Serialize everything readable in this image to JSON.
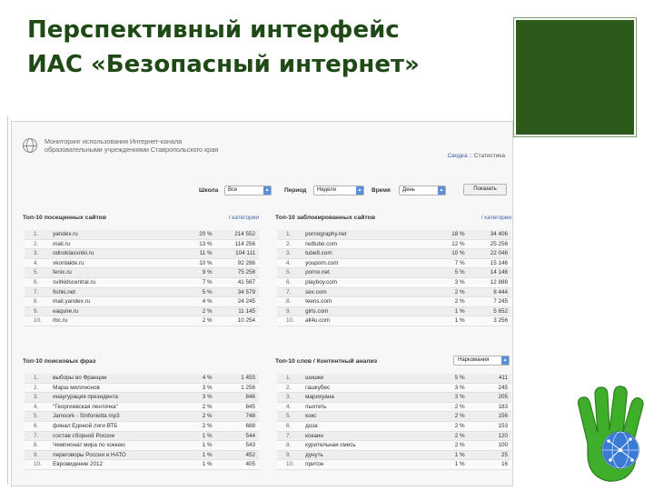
{
  "slide": {
    "title_line1": "Перспективный интерфейс",
    "title_line2": "ИАС «Безопасный интернет»"
  },
  "app": {
    "title_line1": "Мониторинг использования Интернет-канала",
    "title_line2": "образовательными учреждениями Ставропольского края",
    "nav": {
      "link1": "Сводка",
      "sep": "::",
      "link2": "Статистика"
    }
  },
  "filters": {
    "school_label": "Школа",
    "school_value": "Все",
    "period_label": "Период",
    "period_value": "Неделя",
    "time_label": "Время",
    "time_value": "День",
    "show_button": "Показать"
  },
  "panels": {
    "visited": {
      "title": "Топ-10 посещенных сайтов",
      "link": "/ категории",
      "rows": [
        {
          "n": "1.",
          "name": "yandex.ru",
          "pct": "20 %",
          "count": "214 552"
        },
        {
          "n": "2.",
          "name": "mail.ru",
          "pct": "13 %",
          "count": "114 256"
        },
        {
          "n": "3.",
          "name": "odnoklassniki.ru",
          "pct": "11 %",
          "count": "104 111"
        },
        {
          "n": "4.",
          "name": "vkontakte.ru",
          "pct": "10 %",
          "count": "92 286"
        },
        {
          "n": "5.",
          "name": "fenix.ru",
          "pct": "9 %",
          "count": "75 258"
        },
        {
          "n": "6.",
          "name": "svitkidscentral.ru",
          "pct": "7 %",
          "count": "41 567"
        },
        {
          "n": "7.",
          "name": "fishki.net",
          "pct": "5 %",
          "count": "34 579"
        },
        {
          "n": "8.",
          "name": "mail.yandex.ru",
          "pct": "4 %",
          "count": "24 245"
        },
        {
          "n": "9.",
          "name": "eaquire.ru",
          "pct": "2 %",
          "count": "11 145"
        },
        {
          "n": "10.",
          "name": "rbc.ru",
          "pct": "2 %",
          "count": "10 254"
        }
      ]
    },
    "blocked": {
      "title": "Топ-10 заблокированных сайтов",
      "link": "/ категории",
      "rows": [
        {
          "n": "1.",
          "name": "pornography.net",
          "pct": "18 %",
          "count": "34 406"
        },
        {
          "n": "2.",
          "name": "redtube.com",
          "pct": "12 %",
          "count": "25 256"
        },
        {
          "n": "3.",
          "name": "tube8.com",
          "pct": "10 %",
          "count": "22 046"
        },
        {
          "n": "4.",
          "name": "youporn.com",
          "pct": "7 %",
          "count": "15 146"
        },
        {
          "n": "5.",
          "name": "porno.net",
          "pct": "5 %",
          "count": "14 146"
        },
        {
          "n": "6.",
          "name": "playboy.com",
          "pct": "3 %",
          "count": "12 888"
        },
        {
          "n": "7.",
          "name": "sex.com",
          "pct": "2 %",
          "count": "8 444"
        },
        {
          "n": "8.",
          "name": "teens.com",
          "pct": "2 %",
          "count": "7 245"
        },
        {
          "n": "9.",
          "name": "girls.com",
          "pct": "1 %",
          "count": "5 652"
        },
        {
          "n": "10.",
          "name": "all4u.com",
          "pct": "1 %",
          "count": "3 256"
        }
      ]
    },
    "phrases": {
      "title": "Топ-10 поисковых фраз",
      "rows": [
        {
          "n": "1.",
          "name": "выборы во Франции",
          "pct": "4 %",
          "count": "1 455"
        },
        {
          "n": "2.",
          "name": "Марш миллионов",
          "pct": "3 %",
          "count": "1 256"
        },
        {
          "n": "3.",
          "name": "инаугурация президента",
          "pct": "3 %",
          "count": "846"
        },
        {
          "n": "4.",
          "name": "\"Георгиевская ленточка\"",
          "pct": "2 %",
          "count": "845"
        },
        {
          "n": "5.",
          "name": "Jamoork - Sinfonietta mp3",
          "pct": "2 %",
          "count": "748"
        },
        {
          "n": "6.",
          "name": "финал Единой лиги ВТБ",
          "pct": "2 %",
          "count": "688"
        },
        {
          "n": "7.",
          "name": "состав сборной России",
          "pct": "1 %",
          "count": "544"
        },
        {
          "n": "8.",
          "name": "Чемпионат мира по хоккею",
          "pct": "1 %",
          "count": "543"
        },
        {
          "n": "9.",
          "name": "переговоры России и НАТО",
          "pct": "1 %",
          "count": "452"
        },
        {
          "n": "10.",
          "name": "Евровидение 2012",
          "pct": "1 %",
          "count": "405"
        }
      ]
    },
    "words": {
      "title": "Топ-10 слов / Контентный анализ",
      "select": "Наркомания",
      "rows": [
        {
          "n": "1.",
          "name": "шишки",
          "pct": "5 %",
          "count": "411"
        },
        {
          "n": "2.",
          "name": "гашкубес",
          "pct": "3 %",
          "count": "245"
        },
        {
          "n": "3.",
          "name": "марихуана",
          "pct": "3 %",
          "count": "205"
        },
        {
          "n": "4.",
          "name": "пыхтеть",
          "pct": "2 %",
          "count": "183"
        },
        {
          "n": "5.",
          "name": "кокс",
          "pct": "2 %",
          "count": "156"
        },
        {
          "n": "6.",
          "name": "доза",
          "pct": "2 %",
          "count": "153"
        },
        {
          "n": "7.",
          "name": "кокаин",
          "pct": "2 %",
          "count": "120"
        },
        {
          "n": "8.",
          "name": "курительная смесь",
          "pct": "2 %",
          "count": "100"
        },
        {
          "n": "9.",
          "name": "дунуть",
          "pct": "1 %",
          "count": "25"
        },
        {
          "n": "10.",
          "name": "притон",
          "pct": "1 %",
          "count": "16"
        }
      ]
    }
  },
  "colors": {
    "title": "#1f4a16",
    "green_box": "#2d5a1a",
    "link": "#3a62a8",
    "hand": "#3fae2a"
  },
  "icons": {
    "header": "globe-icon",
    "corner": "hand-globe-icon"
  }
}
